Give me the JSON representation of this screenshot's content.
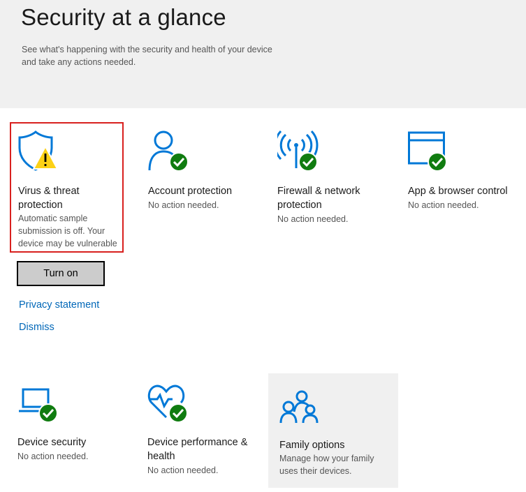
{
  "header": {
    "title": "Security at a glance",
    "subtitle_line1": "See what's happening with the security and health of your device",
    "subtitle_line2": "and take any actions needed."
  },
  "tiles": {
    "virus": {
      "icon": "shield-warning-icon",
      "title_line1": "Virus & threat",
      "title_line2": "protection",
      "status_line1": "Automatic sample",
      "status_line2": "submission is off. Your",
      "status_line3": "device may be vulnerable",
      "button_label": "Turn on",
      "link_privacy": "Privacy statement",
      "link_dismiss": "Dismiss"
    },
    "account": {
      "icon": "person-check-icon",
      "title": "Account protection",
      "status": "No action needed."
    },
    "firewall": {
      "icon": "wireless-check-icon",
      "title_line1": "Firewall & network",
      "title_line2": "protection",
      "status": "No action needed."
    },
    "browser": {
      "icon": "browser-window-check-icon",
      "title": "App & browser control",
      "status": "No action needed."
    },
    "device_security": {
      "icon": "laptop-check-icon",
      "title": "Device security",
      "status": "No action needed."
    },
    "performance": {
      "icon": "heart-pulse-check-icon",
      "title_line1": "Device performance &",
      "title_line2": "health",
      "status": "No action needed."
    },
    "family": {
      "icon": "family-icon",
      "title": "Family options",
      "status_line1": "Manage how your family",
      "status_line2": "uses their devices."
    }
  },
  "colors": {
    "accent_blue": "#0078d7",
    "check_green": "#107c10",
    "warning_yellow": "#fcd116",
    "highlight_red": "#d8201e",
    "link_blue": "#0067b8"
  }
}
